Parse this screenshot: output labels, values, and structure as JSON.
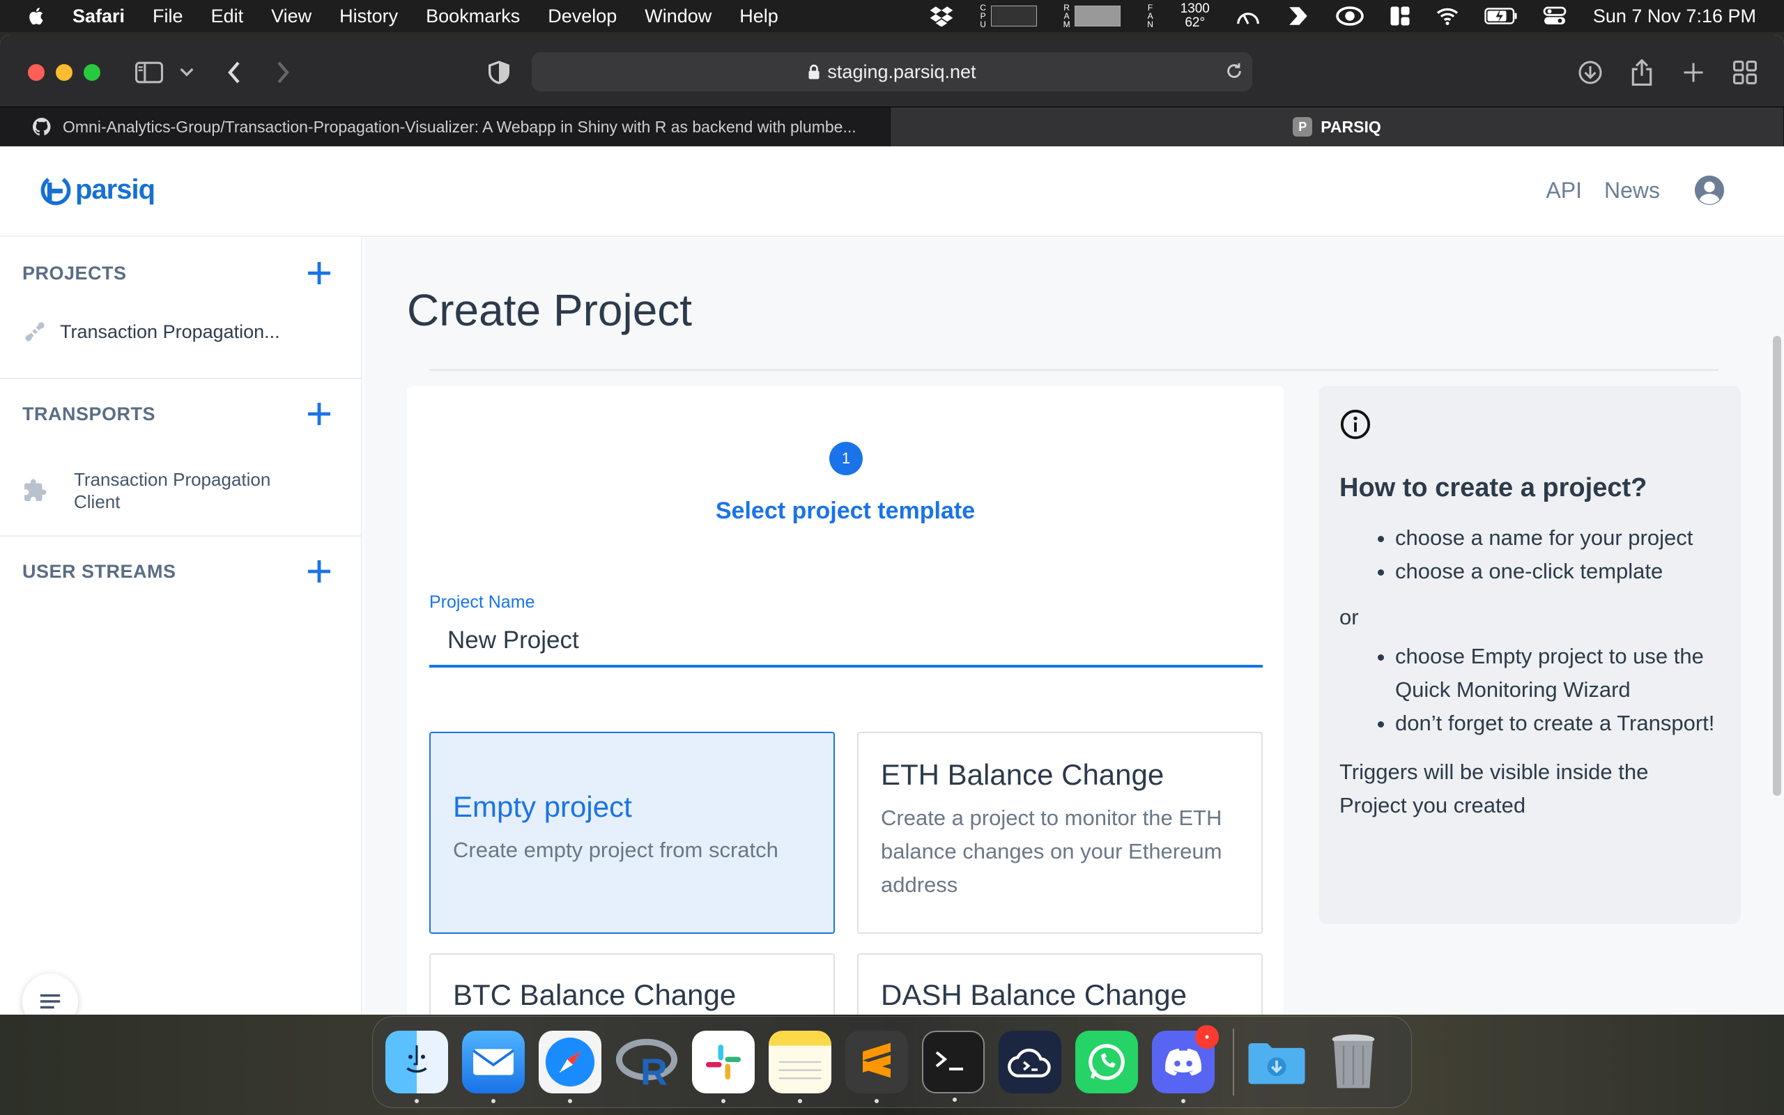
{
  "menubar": {
    "app_name": "Safari",
    "items": [
      "File",
      "Edit",
      "View",
      "History",
      "Bookmarks",
      "Develop",
      "Window",
      "Help"
    ],
    "cpu_label": "CPU",
    "ram_label": "RAM",
    "fan_label": "FAN",
    "fan_rpm": "1300",
    "temperature": "62°",
    "clock": "Sun 7 Nov  7:16 PM"
  },
  "browser": {
    "url": "staging.parsiq.net",
    "tabs": [
      {
        "title": "Omni-Analytics-Group/Transaction-Propagation-Visualizer: A Webapp in Shiny with R as backend with plumbe...",
        "active": false,
        "favicon": "github-icon"
      },
      {
        "title": "PARSIQ",
        "active": true,
        "favicon": "P"
      }
    ]
  },
  "header": {
    "logo_text": "parsiq",
    "links": [
      "API",
      "News"
    ]
  },
  "sidebar": {
    "projects_title": "PROJECTS",
    "project_item": "Transaction Propagation...",
    "transports_title": "TRANSPORTS",
    "transport_item": "Transaction Propagation Client",
    "streams_title": "USER STREAMS"
  },
  "main": {
    "page_title": "Create Project",
    "step_number": "1",
    "step_label": "Select project template",
    "project_name_label": "Project Name",
    "project_name_value": "New Project",
    "templates": [
      {
        "title": "Empty project",
        "desc": "Create empty project from scratch",
        "selected": true
      },
      {
        "title": "ETH Balance Change",
        "desc": "Create a project to monitor the ETH balance changes on your Ethereum address",
        "selected": false
      },
      {
        "title": "BTC Balance Change",
        "desc": "",
        "selected": false
      },
      {
        "title": "DASH Balance Change",
        "desc": "",
        "selected": false
      }
    ]
  },
  "help": {
    "title": "How to create a project?",
    "list1": [
      "choose a name for your project",
      "choose a one-click template"
    ],
    "or": "or",
    "list2": [
      "choose Empty project to use the Quick Monitoring Wizard",
      "don’t forget to create a Transport!"
    ],
    "footer": "Triggers will be visible inside the Project you created"
  },
  "dock": {
    "apps": [
      "finder-icon",
      "mail-icon",
      "safari-icon",
      "r-icon",
      "slack-icon",
      "notes-icon",
      "sublime-icon",
      "terminal-icon",
      "cloud-terminal-icon",
      "whatsapp-icon",
      "discord-icon",
      "downloads-folder-icon",
      "trash-icon"
    ],
    "discord_badge": "•"
  },
  "colors": {
    "accent": "#1a73e8",
    "brand": "#1670d2",
    "selected_bg": "#e6f0fd"
  }
}
